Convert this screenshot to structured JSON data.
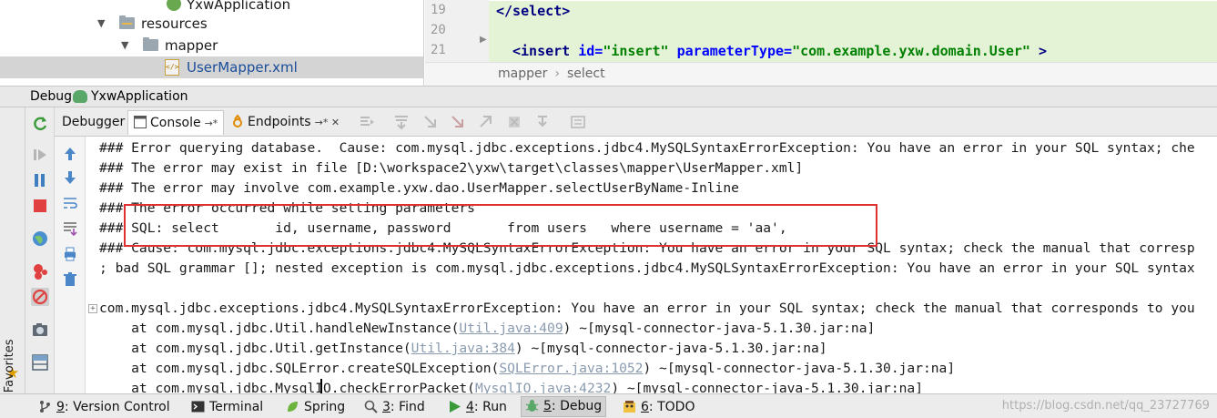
{
  "tree": {
    "items": [
      {
        "label": "YxwApplication"
      },
      {
        "label": "resources"
      },
      {
        "label": "mapper"
      },
      {
        "label": "UserMapper.xml"
      }
    ]
  },
  "editor": {
    "line_numbers": [
      "19",
      "20",
      "21"
    ],
    "line19": {
      "tag": "</select>"
    },
    "line21": {
      "open": "<insert",
      "attr1": " id=",
      "val1": "\"insert\"",
      "attr2": " parameterType=",
      "val2": "\"com.example.yxw.domain.User\"",
      "close": " >"
    },
    "breadcrumb": [
      "mapper",
      "select"
    ]
  },
  "debug_bar": {
    "label": "Debug",
    "config": "YxwApplication"
  },
  "tabs": {
    "debugger": "Debugger",
    "console": "Console",
    "endpoints": "Endpoints",
    "console_pin": "→*",
    "endpoints_pin": "→* ✕"
  },
  "console": {
    "lines": [
      "### Error querying database.  Cause: com.mysql.jdbc.exceptions.jdbc4.MySQLSyntaxErrorException: You have an error in your SQL syntax; che",
      "### The error may exist in file [D:\\workspace2\\yxw\\target\\classes\\mapper\\UserMapper.xml]",
      "### The error may involve com.example.yxw.dao.UserMapper.selectUserByName-Inline",
      "### The error occurred while setting parameters",
      "### SQL: select       id, username, password       from users   where username = 'aa',",
      "### Cause: com.mysql.jdbc.exceptions.jdbc4.MySQLSyntaxErrorException: You have an error in your SQL syntax; check the manual that corresp",
      "; bad SQL grammar []; nested exception is com.mysql.jdbc.exceptions.jdbc4.MySQLSyntaxErrorException: You have an error in your SQL syntax",
      "",
      "com.mysql.jdbc.exceptions.jdbc4.MySQLSyntaxErrorException: You have an error in your SQL syntax; check the manual that corresponds to you"
    ],
    "stack": [
      {
        "pre": "    at com.mysql.jdbc.Util.handleNewInstance(",
        "link": "Util.java:409",
        "post": ") ~[mysql-connector-java-5.1.30.jar:na]"
      },
      {
        "pre": "    at com.mysql.jdbc.Util.getInstance(",
        "link": "Util.java:384",
        "post": ") ~[mysql-connector-java-5.1.30.jar:na]"
      },
      {
        "pre": "    at com.mysql.jdbc.SQLError.createSQLException(",
        "link": "SQLError.java:1052",
        "post": ") ~[mysql-connector-java-5.1.30.jar:na]"
      },
      {
        "pre": "    at com.mysql.jdbc.MysqlIO.checkErrorPacket(",
        "link": "MysqlIO.java:4232",
        "post": ") ~[mysql-connector-java-5.1.30.jar:na]"
      }
    ]
  },
  "favorites": {
    "label": "2: Favorites"
  },
  "statusbar": {
    "version_control": {
      "key": "9",
      "label": ": Version Control"
    },
    "terminal": {
      "label": "Terminal"
    },
    "spring": {
      "label": "Spring"
    },
    "find": {
      "key": "3",
      "label": ": Find"
    },
    "run": {
      "key": "4",
      "label": ": Run"
    },
    "debug": {
      "key": "5",
      "label": ": Debug"
    },
    "todo": {
      "key": "6",
      "label": ": TODO"
    },
    "watermark": "https://blog.csdn.net/qq_23727769"
  },
  "colors": {
    "highlight_box": "#e0302f",
    "editor_highlight": "#e4f3d6",
    "tag": "#000080",
    "attr": "#0000ff",
    "value": "#008000"
  }
}
